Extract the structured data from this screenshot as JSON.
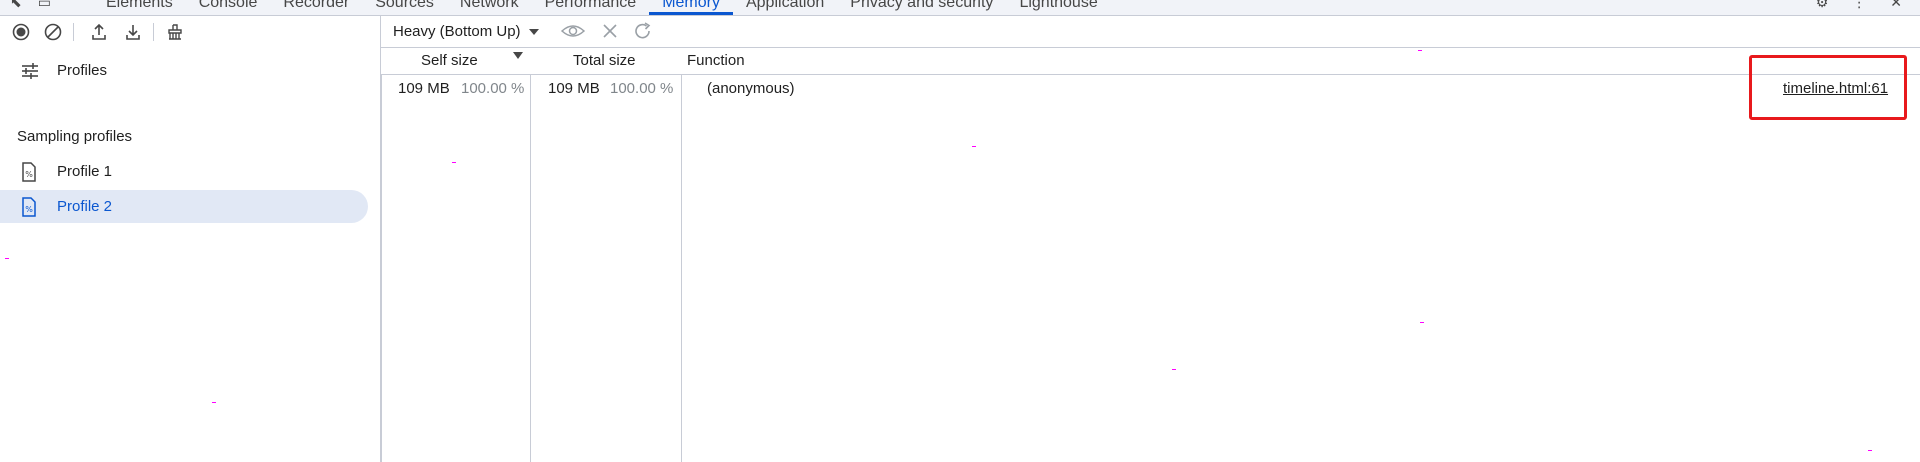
{
  "top_tabs": [
    {
      "label": "Elements"
    },
    {
      "label": "Console"
    },
    {
      "label": "Recorder"
    },
    {
      "label": "Sources"
    },
    {
      "label": "Network"
    },
    {
      "label": "Performance"
    },
    {
      "label": "Memory",
      "active": true
    },
    {
      "label": "Application"
    },
    {
      "label": "Privacy and security"
    },
    {
      "label": "Lighthouse"
    }
  ],
  "left_toolbar": {
    "icons": [
      "record-icon",
      "clear-icon",
      "upload-icon",
      "download-icon",
      "garbage-collect-icon"
    ]
  },
  "sidebar": {
    "profiles_label": "Profiles",
    "section_title": "Sampling profiles",
    "items": [
      {
        "label": "Profile 1",
        "selected": false
      },
      {
        "label": "Profile 2",
        "selected": true
      }
    ]
  },
  "view": {
    "selected": "Heavy (Bottom Up)"
  },
  "table": {
    "columns": {
      "self_size": "Self size",
      "total_size": "Total size",
      "function": "Function"
    },
    "rows": [
      {
        "self_size": "109 MB",
        "self_pct": "100.00 %",
        "total_size": "109 MB",
        "total_pct": "100.00 %",
        "function": "(anonymous)",
        "source": "timeline.html:61"
      }
    ]
  },
  "colors": {
    "accent": "#0b57d0",
    "selected_bg": "#e1e8f5",
    "highlight": "#e8191c"
  }
}
